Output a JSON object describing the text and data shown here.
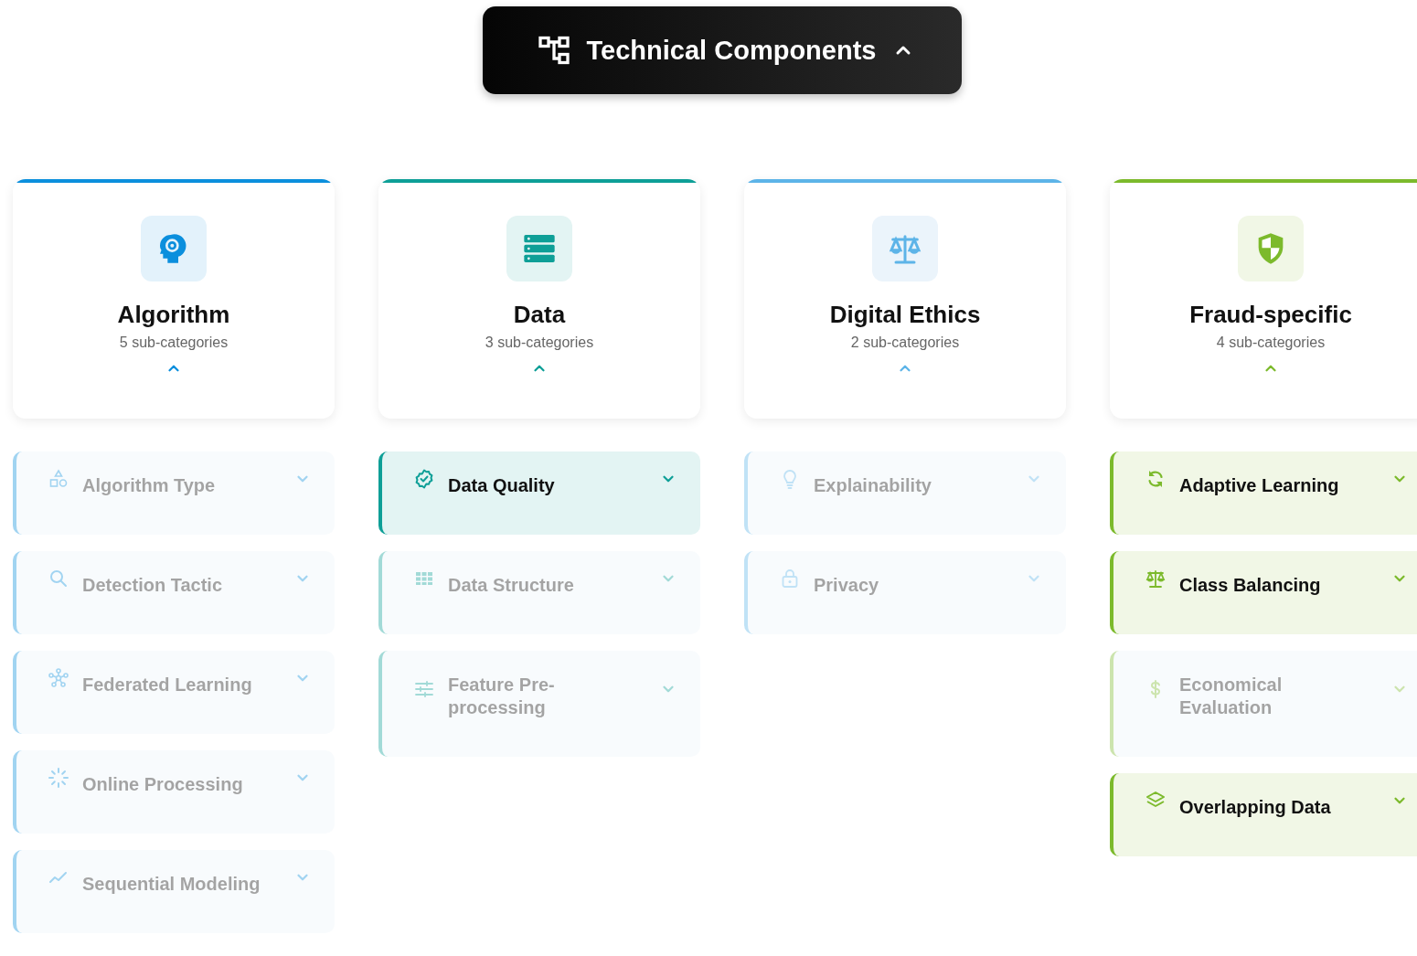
{
  "header": {
    "title": "Technical Components",
    "expanded": true
  },
  "categories": [
    {
      "title": "Algorithm",
      "count": "5 sub-categories",
      "color": "#0b8fdd",
      "expanded": true,
      "subcategories": [
        {
          "label": "Algorithm Type",
          "highlighted": false,
          "expanded": false
        },
        {
          "label": "Detection Tactic",
          "highlighted": false,
          "expanded": false
        },
        {
          "label": "Federated Learning",
          "highlighted": false,
          "expanded": false
        },
        {
          "label": "Online Processing",
          "highlighted": false,
          "expanded": false
        },
        {
          "label": "Sequential Modeling",
          "highlighted": false,
          "expanded": false
        }
      ]
    },
    {
      "title": "Data",
      "count": "3 sub-categories",
      "color": "#0e9f97",
      "expanded": true,
      "subcategories": [
        {
          "label": "Data Quality",
          "highlighted": true,
          "expanded": false
        },
        {
          "label": "Data Structure",
          "highlighted": false,
          "expanded": false
        },
        {
          "label": "Feature Pre-processing",
          "highlighted": false,
          "expanded": false
        }
      ]
    },
    {
      "title": "Digital Ethics",
      "count": "2 sub-categories",
      "color": "#5db4e8",
      "expanded": true,
      "subcategories": [
        {
          "label": "Explainability",
          "highlighted": false,
          "expanded": false
        },
        {
          "label": "Privacy",
          "highlighted": false,
          "expanded": false
        }
      ]
    },
    {
      "title": "Fraud-specific",
      "count": "4 sub-categories",
      "color": "#7cba2c",
      "expanded": true,
      "subcategories": [
        {
          "label": "Adaptive Learning",
          "highlighted": true,
          "expanded": false
        },
        {
          "label": "Class Balancing",
          "highlighted": true,
          "expanded": false
        },
        {
          "label": "Economical Evaluation",
          "highlighted": false,
          "expanded": false
        },
        {
          "label": "Overlapping Data",
          "highlighted": true,
          "expanded": false
        }
      ]
    }
  ]
}
